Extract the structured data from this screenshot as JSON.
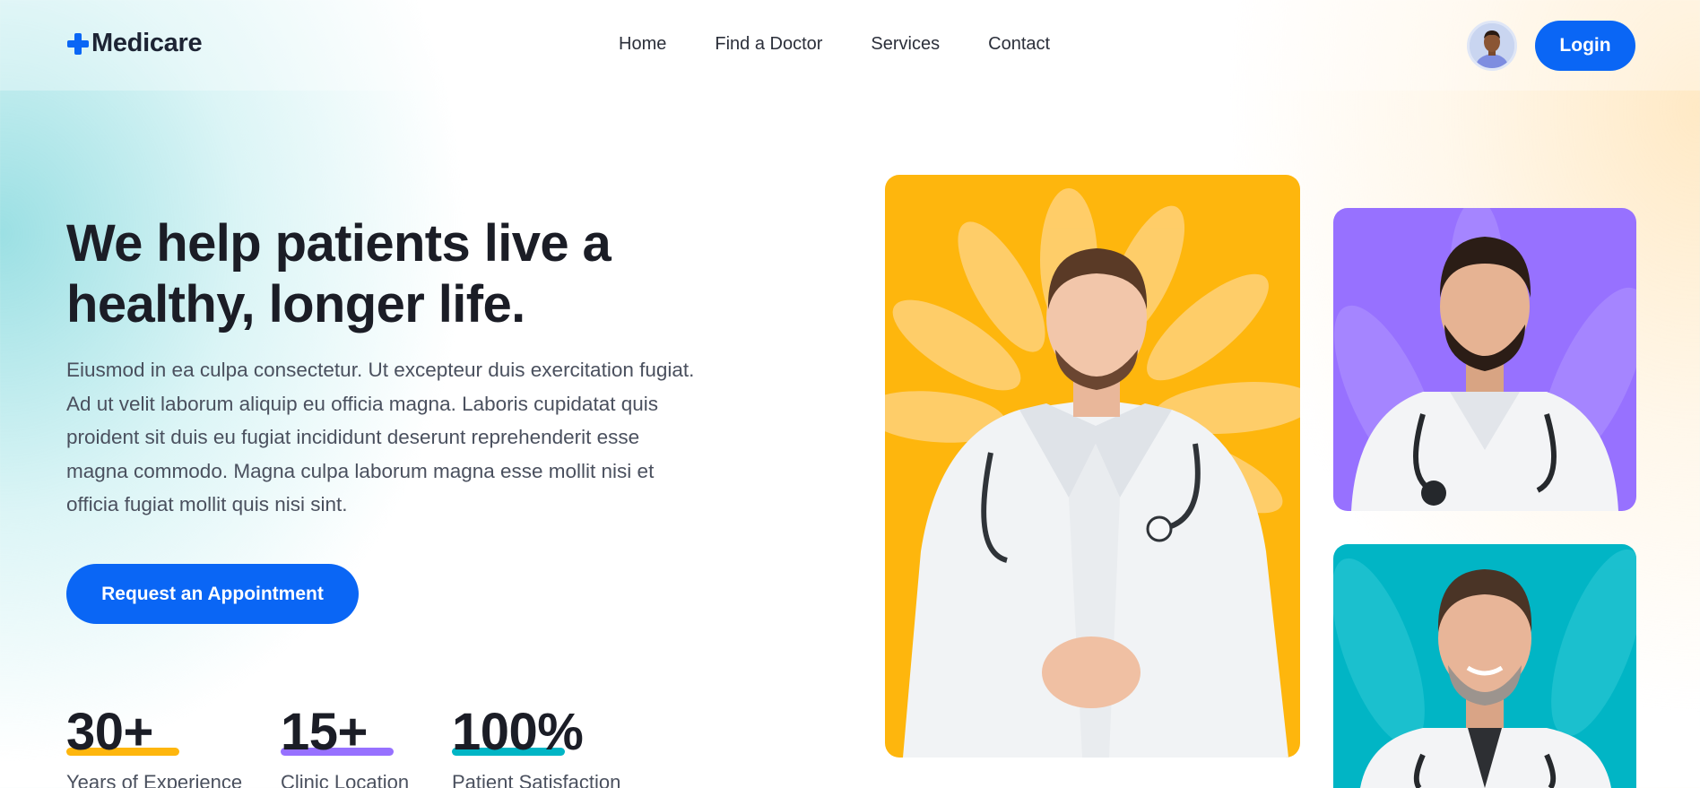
{
  "brand": {
    "name": "Medicare",
    "accent": "#0a66f5"
  },
  "nav": {
    "items": [
      {
        "label": "Home"
      },
      {
        "label": "Find a Doctor"
      },
      {
        "label": "Services"
      },
      {
        "label": "Contact"
      }
    ],
    "login_label": "Login"
  },
  "hero": {
    "title": "We help patients live a healthy, longer life.",
    "description": "Eiusmod in ea culpa consectetur. Ut excepteur duis exercitation fugiat. Ad ut velit laborum aliquip eu officia magna. Laboris cupidatat quis proident sit duis eu fugiat incididunt deserunt reprehenderit esse magna commodo. Magna culpa laborum magna esse mollit nisi et officia fugiat mollit quis nisi sint.",
    "cta_label": "Request an Appointment"
  },
  "stats": [
    {
      "value": "30+",
      "label": "Years of Experience",
      "color": "#feb60d"
    },
    {
      "value": "15+",
      "label": "Clinic Location",
      "color": "#9771ff"
    },
    {
      "value": "100%",
      "label": "Patient Satisfaction",
      "color": "#01b5c5"
    }
  ],
  "doctor_cards": [
    {
      "bg": "#feb60d",
      "icon": "doctor-photo"
    },
    {
      "bg": "#9771ff",
      "icon": "doctor-photo"
    },
    {
      "bg": "#01b5c5",
      "icon": "doctor-photo"
    }
  ]
}
